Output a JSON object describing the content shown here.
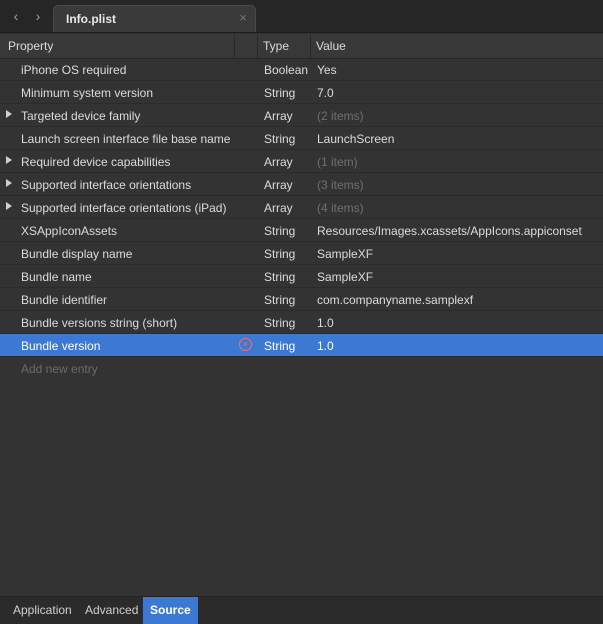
{
  "tab": {
    "title": "Info.plist",
    "close": "×"
  },
  "header": {
    "property": "Property",
    "type": "Type",
    "value": "Value"
  },
  "rows": [
    {
      "property": "iPhone OS required",
      "type": "Boolean",
      "value": "Yes",
      "expandable": false
    },
    {
      "property": "Minimum system version",
      "type": "String",
      "value": "7.0",
      "expandable": false
    },
    {
      "property": "Targeted device family",
      "type": "Array",
      "value": "(2 items)",
      "expandable": true
    },
    {
      "property": "Launch screen interface file base name",
      "type": "String",
      "value": "LaunchScreen",
      "expandable": false
    },
    {
      "property": "Required device capabilities",
      "type": "Array",
      "value": "(1 item)",
      "expandable": true
    },
    {
      "property": "Supported interface orientations",
      "type": "Array",
      "value": "(3 items)",
      "expandable": true
    },
    {
      "property": "Supported interface orientations (iPad)",
      "type": "Array",
      "value": "(4 items)",
      "expandable": true
    },
    {
      "property": "XSAppIconAssets",
      "type": "String",
      "value": "Resources/Images.xcassets/AppIcons.appiconset",
      "expandable": false
    },
    {
      "property": "Bundle display name",
      "type": "String",
      "value": "SampleXF",
      "expandable": false
    },
    {
      "property": "Bundle name",
      "type": "String",
      "value": "SampleXF",
      "expandable": false
    },
    {
      "property": "Bundle identifier",
      "type": "String",
      "value": "com.companyname.samplexf",
      "expandable": false
    },
    {
      "property": "Bundle versions string (short)",
      "type": "String",
      "value": "1.0",
      "expandable": false
    },
    {
      "property": "Bundle version",
      "type": "String",
      "value": "1.0",
      "expandable": false,
      "selected": true
    }
  ],
  "add_entry": "Add new entry",
  "bottom_tabs": [
    {
      "label": "Application",
      "active": false
    },
    {
      "label": "Advanced",
      "active": false
    },
    {
      "label": "Source",
      "active": true
    }
  ],
  "colors": {
    "accent": "#3b79d2",
    "background": "#333333"
  }
}
